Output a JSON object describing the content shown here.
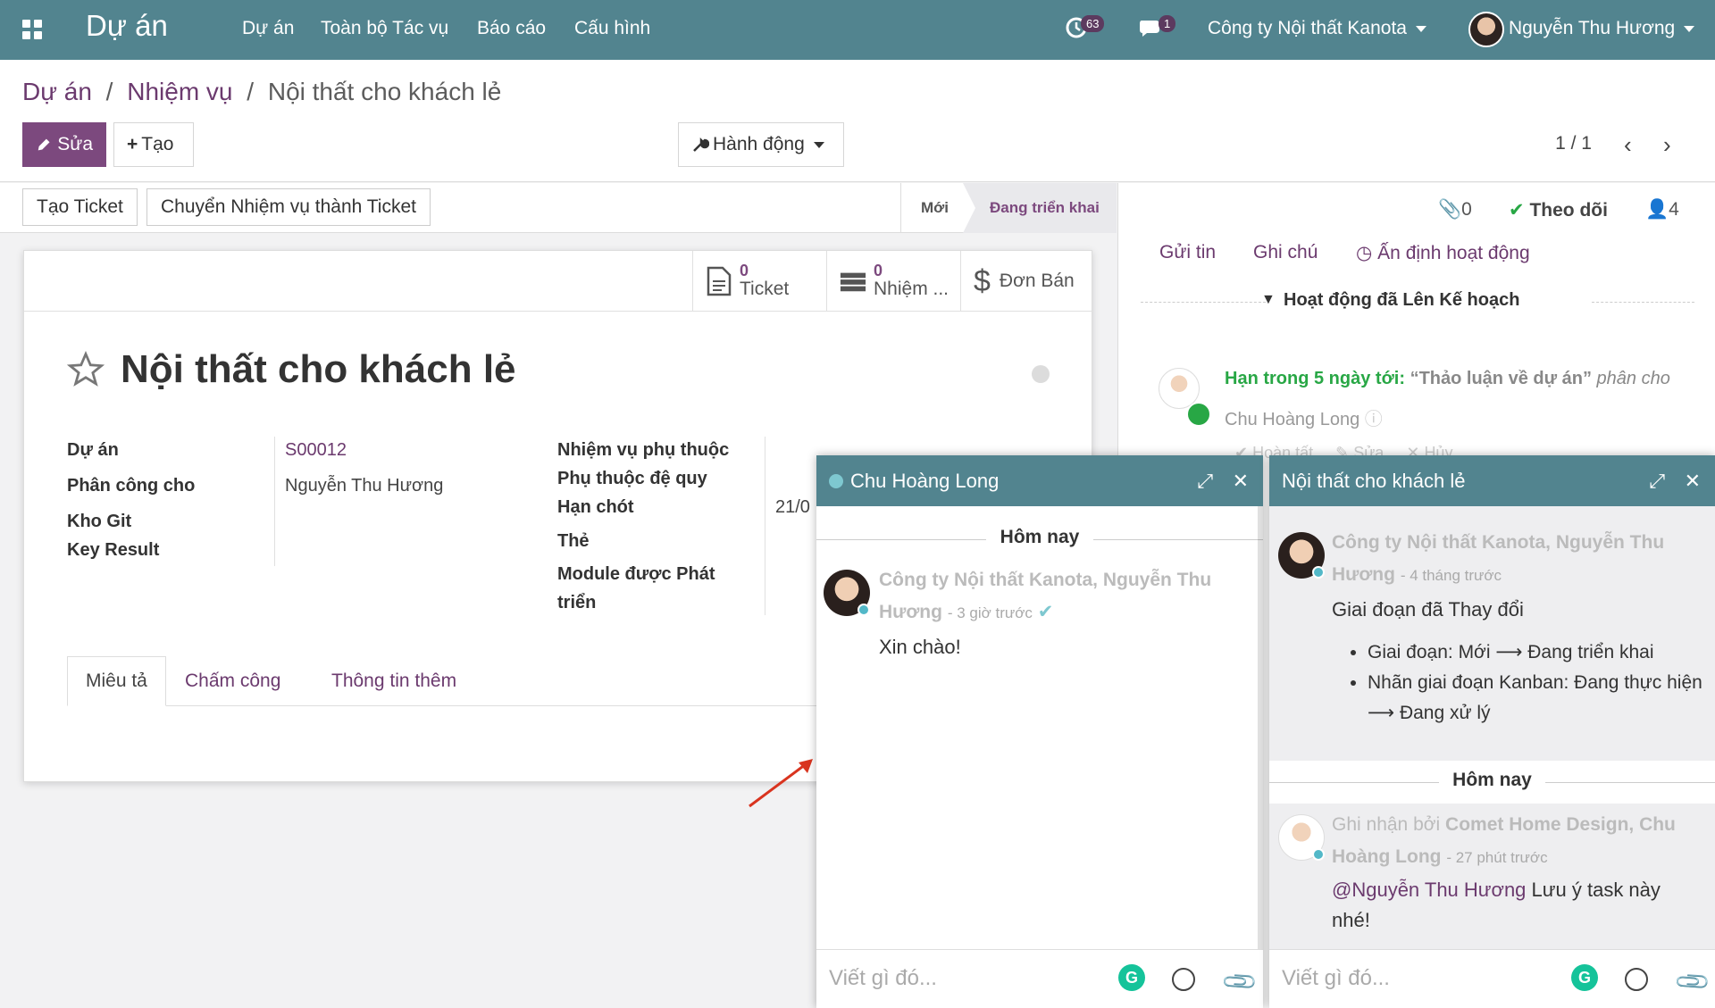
{
  "navbar": {
    "brand": "Dự án",
    "menu": [
      "Dự án",
      "Toàn bộ Tác vụ",
      "Báo cáo",
      "Cấu hình"
    ],
    "activity_count": "63",
    "message_count": "1",
    "company": "Công ty Nội thất Kanota",
    "user": "Nguyễn Thu Hương"
  },
  "breadcrumb": {
    "items": [
      "Dự án",
      "Nhiệm vụ"
    ],
    "separator": "/",
    "current": "Nội thất cho khách lẻ"
  },
  "toolbar": {
    "edit": "Sửa",
    "create": "Tạo",
    "action": "Hành động",
    "pager": "1 / 1"
  },
  "statusbar": {
    "buttons": [
      "Tạo Ticket",
      "Chuyển Nhiệm vụ thành Ticket"
    ],
    "stages": [
      "Mới",
      "Đang triển khai"
    ]
  },
  "smart_buttons": [
    {
      "count": "0",
      "label": "Ticket"
    },
    {
      "count": "0",
      "label": "Nhiệm ..."
    },
    {
      "count": "",
      "label": "Đơn Bán"
    }
  ],
  "form": {
    "title": "Nội thất cho khách lẻ",
    "left_labels": [
      "Dự án",
      "Phân công cho",
      "Kho Git",
      "Key Result"
    ],
    "project_value": "S00012",
    "assignee_value": "Nguyễn Thu Hương",
    "right_labels": [
      "Nhiệm vụ phụ thuộc",
      "Phụ thuộc đệ quy",
      "Hạn chót",
      "Thẻ",
      "Module được Phát triển"
    ],
    "deadline_value": "21/0",
    "tabs": [
      "Miêu tả",
      "Chấm công",
      "Thông tin thêm"
    ]
  },
  "chatter": {
    "attachments": "0",
    "follow": "Theo dõi",
    "followers": "4",
    "send": "Gửi tin",
    "note": "Ghi chú",
    "schedule": "Ấn định hoạt động",
    "planned_header": "Hoạt động đã Lên Kế hoạch",
    "activity_due": "Hạn trong 5 ngày tới:",
    "activity_title": "“Thảo luận về dự án”",
    "activity_assigned": "phân cho",
    "activity_user": "Chu Hoàng Long",
    "activity_actions": [
      "Hoàn tất",
      "Sửa",
      "Hủy"
    ]
  },
  "chat1": {
    "title": "Chu Hoàng Long",
    "day": "Hôm nay",
    "author": "Công ty Nội thất Kanota, Nguyễn Thu Hương",
    "time": "- 3 giờ trước",
    "message": "Xin chào!",
    "placeholder": "Viết gì đó..."
  },
  "chat2": {
    "title": "Nội thất cho khách lẻ",
    "author1": "Công ty Nội thất Kanota, Nguyễn Thu Hương",
    "time1": "- 4 tháng trước",
    "msg1": "Giai đoạn đã Thay đổi",
    "bullet1": "Giai đoạn: Mới ⟶ Đang triển khai",
    "bullet2": "Nhãn giai đoạn Kanban: Đang thực hiện ⟶ Đang xử lý",
    "day": "Hôm nay",
    "author2_prefix": "Ghi nhận bởi",
    "author2": "Comet Home Design, Chu Hoàng Long",
    "time2": "- 27 phút trước",
    "mention": "@Nguyễn Thu Hương",
    "msg2": "Lưu ý task này nhé!",
    "placeholder": "Viết gì đó..."
  },
  "colors": {
    "navbar": "#52848f",
    "primary": "#7c497e",
    "link": "#6b3a6e",
    "annotation_arrow": "#d9341f"
  }
}
